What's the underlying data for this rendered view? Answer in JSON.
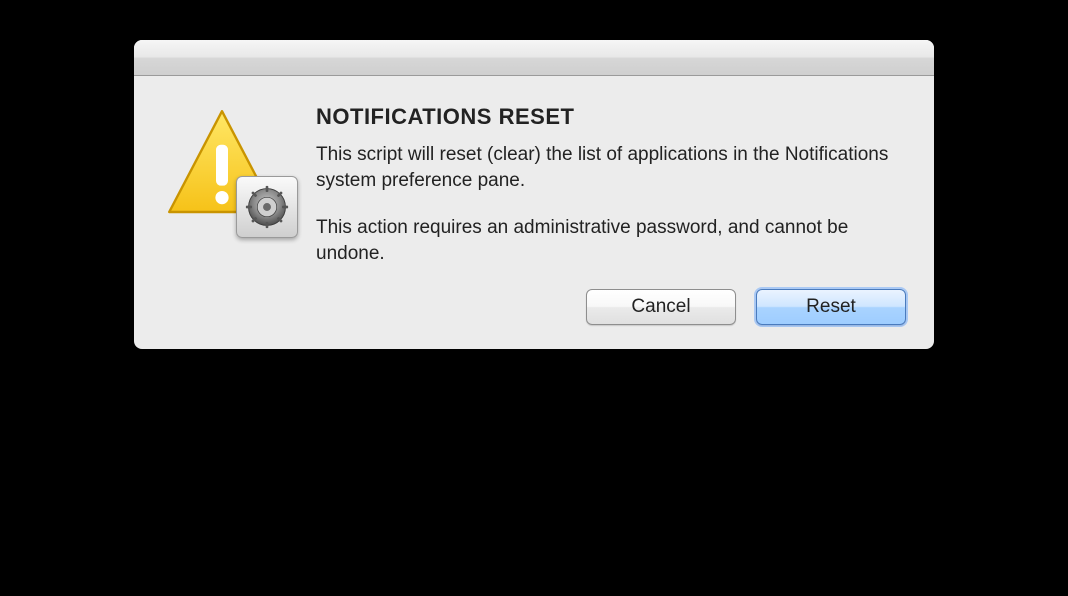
{
  "dialog": {
    "title": "NOTIFICATIONS RESET",
    "message1": "This script will reset (clear) the list of applications in the Notifications system preference pane.",
    "message2": "This action requires an administrative password, and cannot be undone.",
    "icon": "warning-triangle",
    "badge": "system-preferences-gear",
    "buttons": {
      "cancel": "Cancel",
      "default": "Reset"
    }
  }
}
